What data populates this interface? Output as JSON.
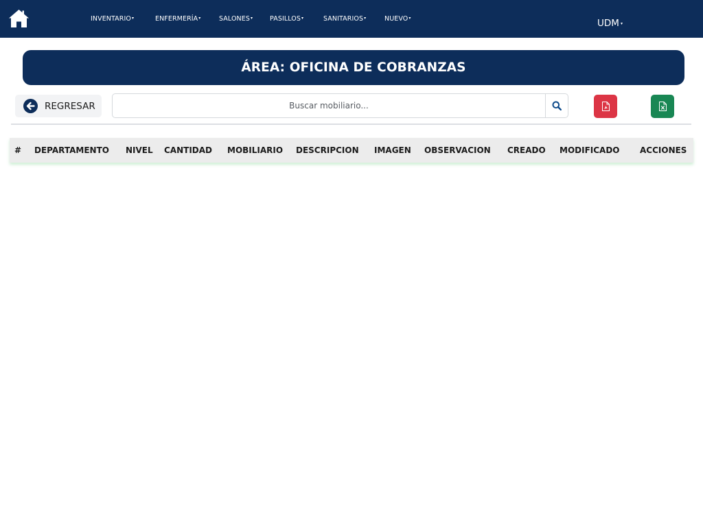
{
  "nav": {
    "home_icon": "home-icon",
    "items": [
      {
        "label": "INVENTARIO",
        "caret": "▾"
      },
      {
        "label": "ENFERMERÍA",
        "caret": "▾"
      },
      {
        "label": "SALONES",
        "caret": "▾"
      },
      {
        "label": "PASILLOS",
        "caret": "▾"
      },
      {
        "label": "SANITARIOS",
        "caret": "▾"
      },
      {
        "label": "NUEVO",
        "caret": "▾"
      }
    ],
    "user": {
      "label": "UDM",
      "caret": "▾"
    }
  },
  "area": {
    "title": "ÁREA: OFICINA DE COBRANZAS"
  },
  "toolbar": {
    "back_label": "REGRESAR",
    "back_icon": "arrow-left-circle-icon",
    "search_placeholder": "Buscar mobiliario...",
    "search_icon": "search-icon",
    "pdf_icon": "file-pdf-icon",
    "excel_icon": "file-excel-icon"
  },
  "table": {
    "columns": [
      "#",
      "DEPARTAMENTO",
      "NIVEL",
      "CANTIDAD",
      "MOBILIARIO",
      "DESCRIPCION",
      "IMAGEN",
      "OBSERVACION",
      "CREADO",
      "MODIFICADO",
      "ACCIONES"
    ],
    "rows": []
  },
  "colors": {
    "primary": "#0d2d5a",
    "pdf": "#dc3545",
    "excel": "#198754",
    "search_icon": "#0d4a8a"
  }
}
